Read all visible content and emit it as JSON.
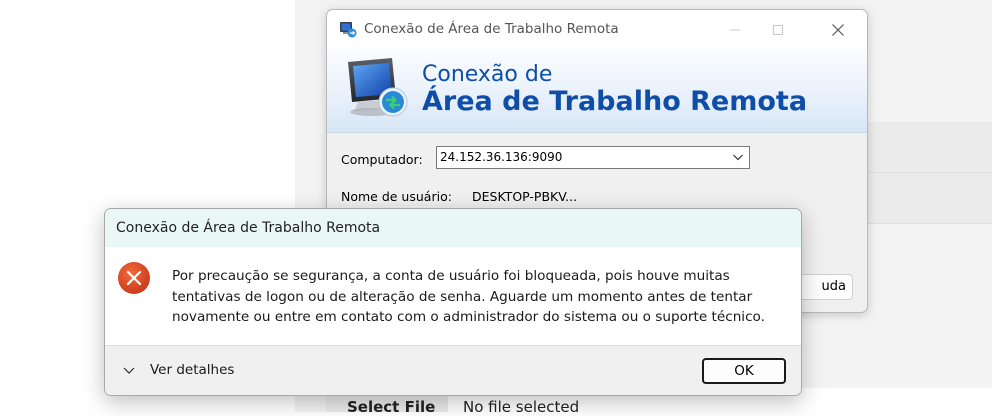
{
  "background": {
    "select_file_label": "Select File",
    "no_file_selected": "No file selected"
  },
  "rdp_window": {
    "title": "Conexão de Área de Trabalho Remota",
    "banner_line1": "Conexão de",
    "banner_line2": "Área de Trabalho Remota",
    "computer_label": "Computador:",
    "computer_value": "24.152.36.136:9090",
    "username_label": "Nome de usuário:",
    "username_value": "DESKTOP-PBKV...",
    "help_button_partial": "uda",
    "icons": {
      "app": "remote-desktop-icon",
      "minimize": "minimize-icon",
      "maximize": "maximize-icon",
      "close": "close-icon",
      "dropdown": "chevron-down-icon"
    }
  },
  "error_dialog": {
    "title": "Conexão de Área de Trabalho Remota",
    "message": "Por precaução se segurança, a conta de usuário foi bloqueada, pois houve muitas tentativas de logon ou de alteração de senha. Aguarde um momento antes de tentar novamente ou entre em contato com o administrador do sistema ou o suporte técnico.",
    "details_label": "Ver detalhes",
    "ok_label": "OK",
    "icons": {
      "error": "error-icon",
      "details": "chevron-down-icon"
    }
  },
  "colors": {
    "banner_text": "#0f4ea8",
    "error_red": "#d83b01",
    "dialog_title_bg": "#e9f7f7"
  }
}
